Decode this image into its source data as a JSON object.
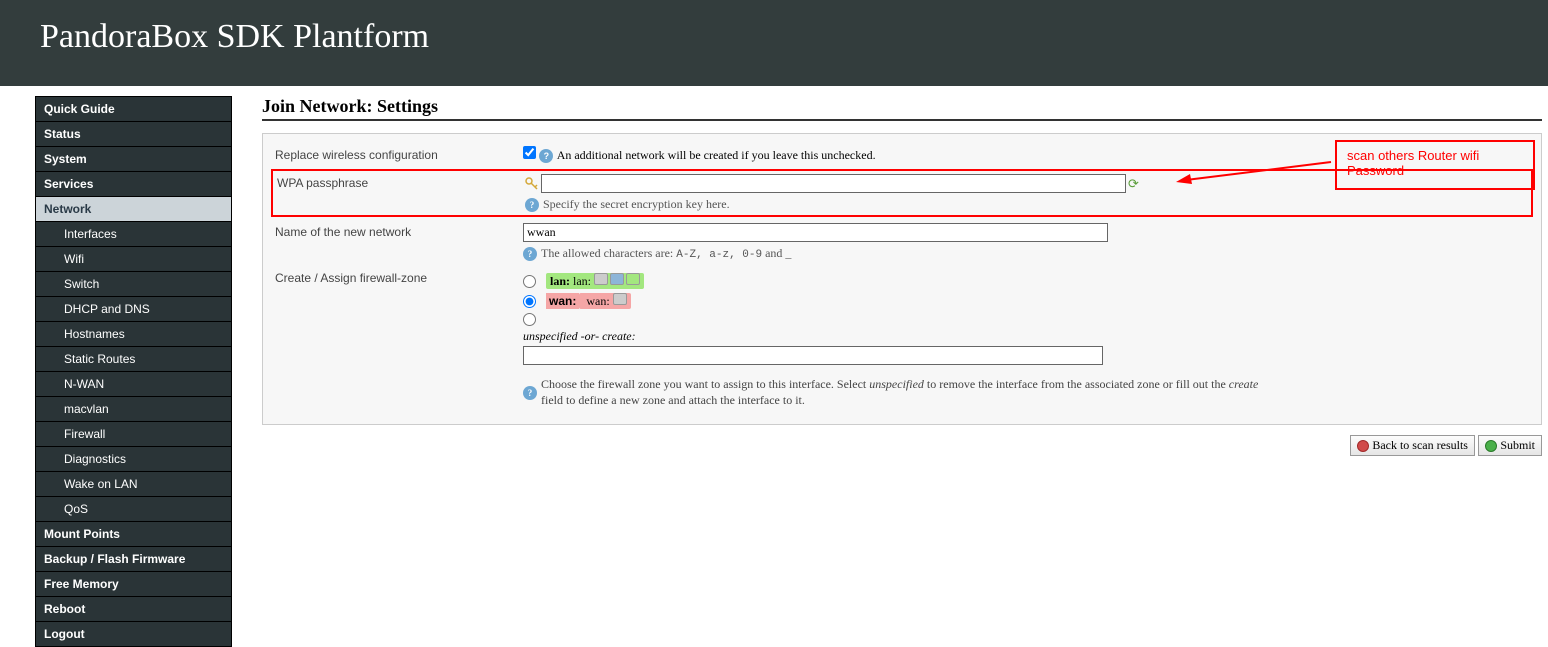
{
  "header": {
    "title": "PandoraBox SDK Plantform"
  },
  "sidebar": {
    "items": [
      {
        "label": "Quick Guide",
        "sub": false,
        "active": false
      },
      {
        "label": "Status",
        "sub": false,
        "active": false
      },
      {
        "label": "System",
        "sub": false,
        "active": false
      },
      {
        "label": "Services",
        "sub": false,
        "active": false
      },
      {
        "label": "Network",
        "sub": false,
        "active": true
      },
      {
        "label": "Interfaces",
        "sub": true,
        "active": false
      },
      {
        "label": "Wifi",
        "sub": true,
        "active": false
      },
      {
        "label": "Switch",
        "sub": true,
        "active": false
      },
      {
        "label": "DHCP and DNS",
        "sub": true,
        "active": false
      },
      {
        "label": "Hostnames",
        "sub": true,
        "active": false
      },
      {
        "label": "Static Routes",
        "sub": true,
        "active": false
      },
      {
        "label": "N-WAN",
        "sub": true,
        "active": false
      },
      {
        "label": "macvlan",
        "sub": true,
        "active": false
      },
      {
        "label": "Firewall",
        "sub": true,
        "active": false
      },
      {
        "label": "Diagnostics",
        "sub": true,
        "active": false
      },
      {
        "label": "Wake on LAN",
        "sub": true,
        "active": false
      },
      {
        "label": "QoS",
        "sub": true,
        "active": false
      },
      {
        "label": "Mount Points",
        "sub": false,
        "active": false
      },
      {
        "label": "Backup / Flash Firmware",
        "sub": false,
        "active": false
      },
      {
        "label": "Free Memory",
        "sub": false,
        "active": false
      },
      {
        "label": "Reboot",
        "sub": false,
        "active": false
      },
      {
        "label": "Logout",
        "sub": false,
        "active": false
      }
    ]
  },
  "page": {
    "title": "Join Network: Settings"
  },
  "form": {
    "replace": {
      "label": "Replace wireless configuration",
      "checked": true,
      "hint": "An additional network will be created if you leave this unchecked."
    },
    "pass": {
      "label": "WPA passphrase",
      "value": "",
      "hint": "Specify the secret encryption key here."
    },
    "name": {
      "label": "Name of the new network",
      "value": "wwan",
      "hint_prefix": "The allowed characters are: ",
      "hint_code": "A-Z, a-z, 0-9",
      "hint_suffix": " and _"
    },
    "zone": {
      "label": "Create / Assign firewall-zone",
      "lan_label": "lan:",
      "lan_suffix": " lan: ",
      "wan_label": "wan:",
      "wan_suffix": " wan: ",
      "unspec_label": "unspecified -or- create:",
      "create_value": "",
      "hint_1": "Choose the firewall zone you want to assign to this interface. Select ",
      "hint_em1": "unspecified",
      "hint_2": " to remove the interface from the associated zone or fill out the ",
      "hint_em2": "create",
      "hint_3": " field to define a new zone and attach the interface to it."
    }
  },
  "annotation": {
    "text": "scan others Router wifi Password"
  },
  "buttons": {
    "back": "Back to scan results",
    "submit": "Submit"
  }
}
